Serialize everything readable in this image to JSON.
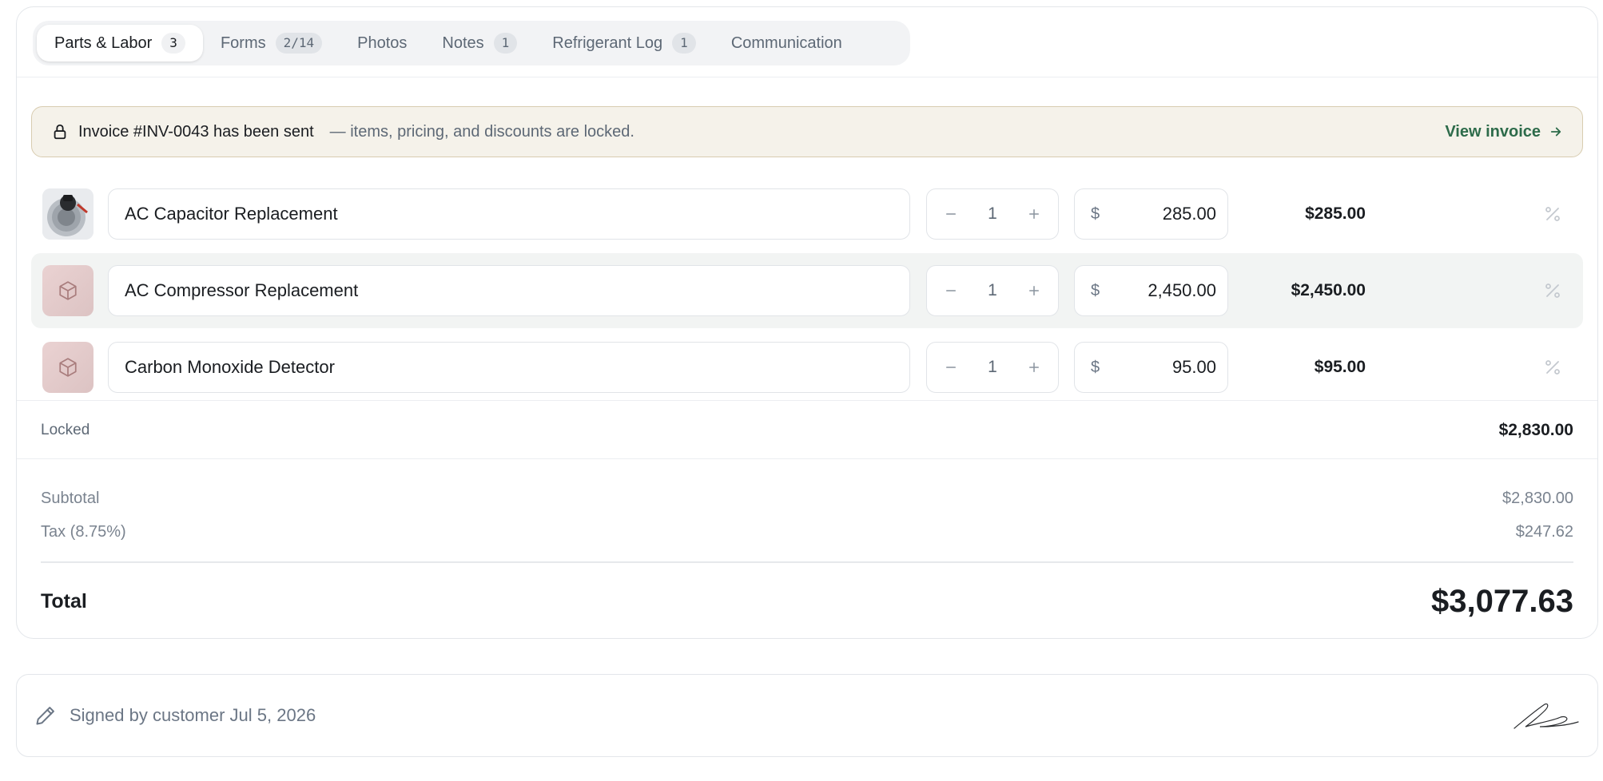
{
  "tabs": [
    {
      "label": "Parts & Labor",
      "badge": "3",
      "active": true
    },
    {
      "label": "Forms",
      "badge": "2/14"
    },
    {
      "label": "Photos",
      "badge": ""
    },
    {
      "label": "Notes",
      "badge": "1"
    },
    {
      "label": "Refrigerant Log",
      "badge": "1"
    },
    {
      "label": "Communication",
      "badge": ""
    }
  ],
  "banner": {
    "title": "Invoice #INV-0043 has been sent",
    "message": "— items, pricing, and discounts are locked.",
    "action": "View invoice",
    "icon": "lock-icon",
    "background": "#f5f2ea",
    "accent": "#2d6b4a"
  },
  "line_items": [
    {
      "name": "AC Capacitor Replacement",
      "qty": "1",
      "currency": "$",
      "price": "285.00",
      "total": "$285.00",
      "thumb": "photo"
    },
    {
      "name": "AC Compressor Replacement",
      "qty": "1",
      "currency": "$",
      "price": "2,450.00",
      "total": "$2,450.00",
      "thumb": "box-icon"
    },
    {
      "name": "Carbon Monoxide Detector",
      "qty": "1",
      "currency": "$",
      "price": "95.00",
      "total": "$95.00",
      "thumb": "box-icon"
    }
  ],
  "locked": {
    "label": "Locked",
    "amount": "$2,830.00"
  },
  "summary": {
    "subtotal_label": "Subtotal",
    "subtotal": "$2,830.00",
    "tax_label": "Tax (8.75%)",
    "tax": "$247.62",
    "total_label": "Total",
    "total": "$3,077.63"
  },
  "signature": {
    "text": "Signed by customer Jul 5, 2026",
    "icon": "pen-icon"
  }
}
